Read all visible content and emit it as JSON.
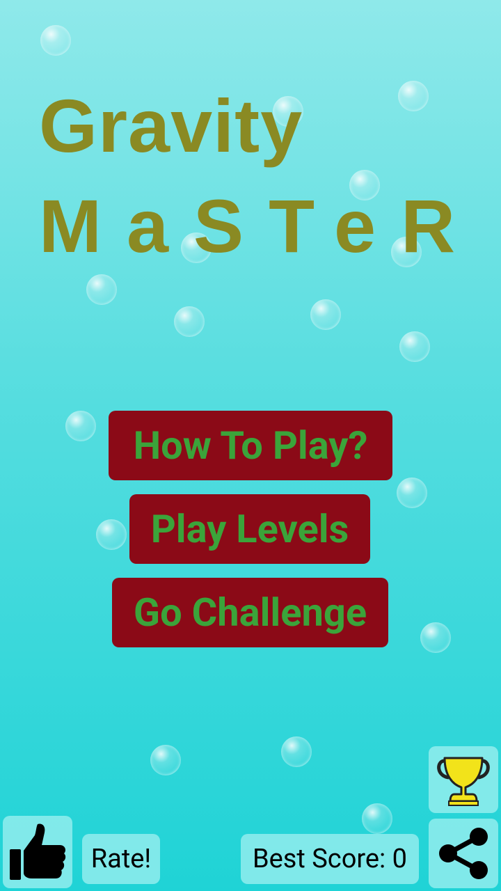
{
  "title": {
    "line1": "Gravity",
    "line2": "MaSTeR"
  },
  "menu": {
    "how_to_play": "How To Play?",
    "play_levels": "Play Levels",
    "go_challenge": "Go Challenge"
  },
  "footer": {
    "rate_label": "Rate!",
    "best_score_label": "Best Score: 0"
  },
  "icons": {
    "thumbs_up": "thumbs-up-icon",
    "trophy": "trophy-icon",
    "share": "share-icon"
  },
  "colors": {
    "title": "#8a8a23",
    "button_bg": "#8b0a17",
    "button_text": "#3ba43a",
    "trophy": "#f2e31a"
  }
}
